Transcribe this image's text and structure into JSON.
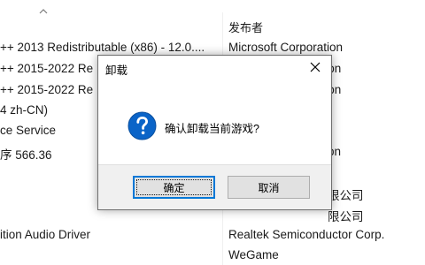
{
  "list": {
    "header_publisher": "发布者",
    "rows": [
      {
        "name": "++ 2013 Redistributable (x86) - 12.0....",
        "publisher": "Microsoft Corporation"
      },
      {
        "name": "++ 2015-2022 Re",
        "publisher": "ation"
      },
      {
        "name": "++ 2015-2022 Re",
        "publisher": "ation"
      },
      {
        "name": "4 zh-CN)",
        "publisher": ""
      },
      {
        "name": "ce Service",
        "publisher": ""
      },
      {
        "name": "序 566.36",
        "publisher": "on"
      },
      {
        "name": "",
        "publisher": "限公司"
      },
      {
        "name": "",
        "publisher": "限公司"
      },
      {
        "name": "ition Audio Driver",
        "publisher": "Realtek Semiconductor Corp."
      },
      {
        "name": "",
        "publisher": "WeGame"
      }
    ]
  },
  "dialog": {
    "title": "卸载",
    "message": "确认卸载当前游戏?",
    "ok_label": "确定",
    "cancel_label": "取消",
    "icon": "question-icon",
    "accent_color": "#0078d7"
  }
}
